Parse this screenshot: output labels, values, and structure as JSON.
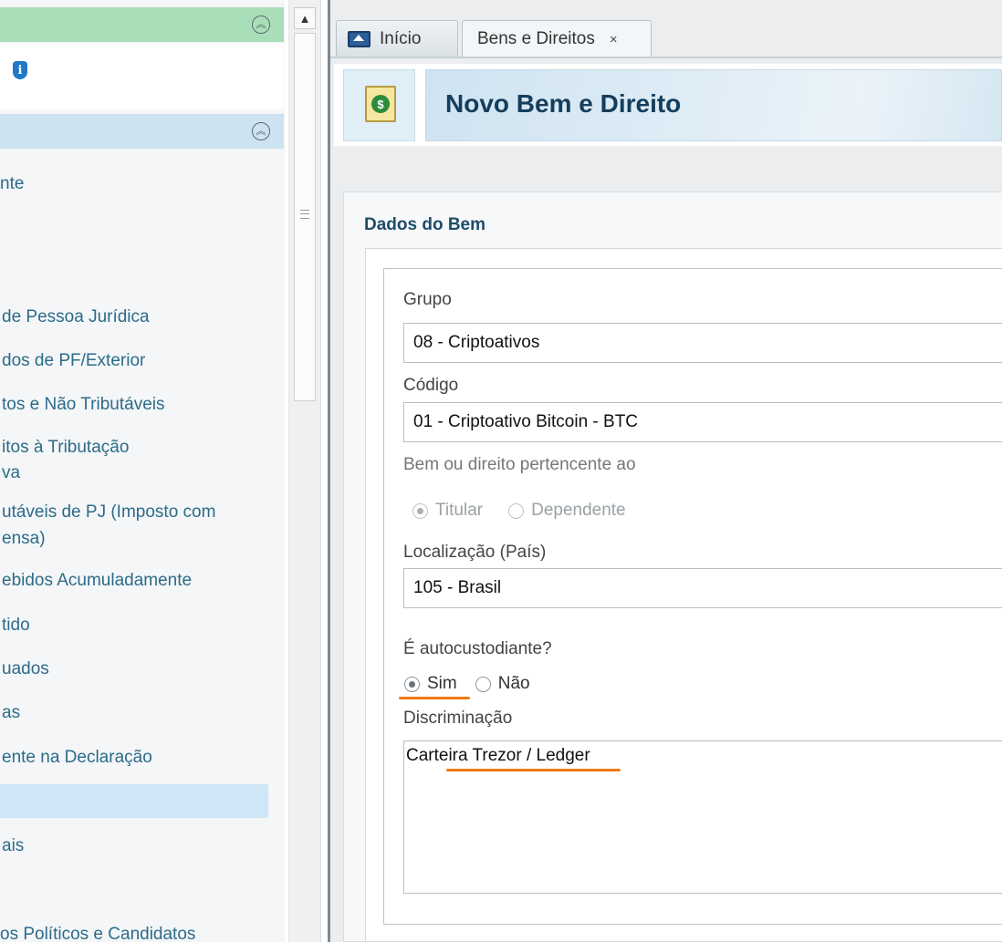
{
  "sidebar": {
    "items": [
      {
        "label": "nte"
      },
      {
        "label": "de Pessoa Jurídica"
      },
      {
        "label": "dos de PF/Exterior"
      },
      {
        "label": "tos e Não Tributáveis"
      },
      {
        "label": "itos à Tributação"
      },
      {
        "label": "va"
      },
      {
        "label": "utáveis de PJ (Imposto com"
      },
      {
        "label": "ensa)"
      },
      {
        "label": "ebidos Acumuladamente"
      },
      {
        "label": "tido"
      },
      {
        "label": "uados"
      },
      {
        "label": "as"
      },
      {
        "label": "ente na Declaração"
      },
      {
        "label": "ais"
      },
      {
        "label": "os Políticos e Candidatos"
      }
    ]
  },
  "tabs": [
    {
      "label": "Início",
      "icon": "home-icon"
    },
    {
      "label": "Bens e Direitos",
      "close": "×"
    }
  ],
  "header": {
    "title": "Novo Bem e Direito",
    "icon": "money-document-icon"
  },
  "form": {
    "section_title": "Dados do Bem",
    "grupo": {
      "label": "Grupo",
      "value": "08 - Criptoativos"
    },
    "codigo": {
      "label": "Código",
      "value": "01 - Criptoativo Bitcoin - BTC"
    },
    "pertencente": {
      "label": "Bem ou direito pertencente ao",
      "options": [
        "Titular",
        "Dependente"
      ],
      "selected": "Titular"
    },
    "localizacao": {
      "label": "Localização (País)",
      "value": "105 - Brasil"
    },
    "autocustodiante": {
      "label": "É autocustodiante?",
      "options": [
        "Sim",
        "Não"
      ],
      "selected": "Sim"
    },
    "discriminacao": {
      "label": "Discriminação",
      "value": "Carteira Trezor / Ledger"
    }
  },
  "colors": {
    "sidebar_header_green": "#a9dfb8",
    "sidebar_header_blue": "#cde3f1",
    "link_text": "#2d6b88",
    "title_text": "#143e5c",
    "annotation_orange": "#f07a12"
  }
}
